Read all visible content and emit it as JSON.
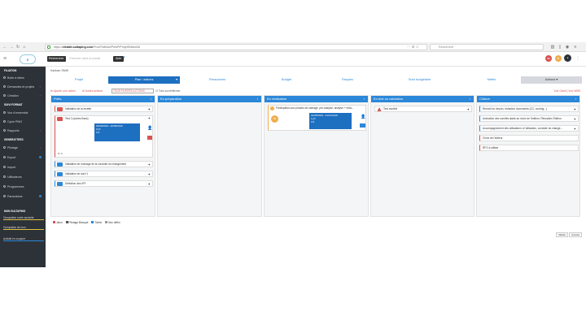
{
  "browser": {
    "url_prefix": "https://",
    "url_domain": "visiativ.sultaping.com",
    "url_path": "/ProcPortfolio/PresP/Projet/Editon0#",
    "search_placeholder": "Rechercher",
    "url_actions": "··· ⊙ ☆"
  },
  "appbar": {
    "search_button": "Rechercher",
    "search_placeholder": "Chercher dans le portail",
    "aide": "Aide",
    "badge_count": "88"
  },
  "sidebar": {
    "section1": "FILIATION",
    "items1": [
      {
        "label": "Boite à idées"
      },
      {
        "label": "Demandes et projets"
      },
      {
        "label": "Création"
      }
    ],
    "section2": "SUIVI FORMAT",
    "items2": [
      {
        "label": "Vue d'ensemble"
      },
      {
        "label": "Cycle PMO"
      },
      {
        "label": "Rapports"
      }
    ],
    "section3": "GENERATTEES",
    "items3": [
      {
        "label": "Pilotage"
      },
      {
        "label": "Export"
      },
      {
        "label": "Import"
      },
      {
        "label": "Utilisateurs"
      },
      {
        "label": "Programmes"
      },
      {
        "label": "Paramètres"
      }
    ],
    "section4": "MON SULTAPING",
    "links": [
      {
        "label": "Occupation conte auxsuite",
        "color": "#e0c040"
      },
      {
        "label": "Occupation de mon",
        "color": "#e0c040"
      },
      {
        "label": "Activité en coupure",
        "color": "#2b87d8"
      }
    ]
  },
  "breadcrumb": "Kanban SMW",
  "tabs": [
    {
      "label": "Projet"
    },
    {
      "label": "Plan / actions"
    },
    {
      "label": "Ressources"
    },
    {
      "label": "Budget"
    },
    {
      "label": "Risques"
    },
    {
      "label": "Suivi budgétaire"
    },
    {
      "label": "Météo"
    },
    {
      "label": "Actions ▾"
    }
  ],
  "toolbar": {
    "add_action": "Ajouter une action",
    "other_actions": "Autres actions",
    "filter": "TOUS FILIERES ACTIONS",
    "checkbox_label": "Tout ouvrir/fermer",
    "right_links": "Vue Gantt | Vue WBS"
  },
  "columns": [
    {
      "title": "Prêts"
    },
    {
      "title": "En préparation"
    },
    {
      "title": "En réalisation"
    },
    {
      "title": "En test ou validation"
    },
    {
      "title": "Clôturé"
    }
  ],
  "col1_cards": [
    {
      "label": "Validation de la recette"
    },
    {
      "label": "Test 2 (autres flows)"
    },
    {
      "label": "Validation de montage de la conduite du changement"
    },
    {
      "label": "Validation de suivi 1"
    },
    {
      "label": "Définition des KPI"
    }
  ],
  "col1_sub": {
    "date": "20/09/2019 - 20/09/2019",
    "line2": "0 j/h",
    "line3": "0 €",
    "counter": "0 / 1"
  },
  "col3_card": {
    "label": "Participation aux phases de cadrage, pré-analyse, analyse + réda..."
  },
  "col3_sub": {
    "date": "01/05/2019 - 31/12/2019",
    "line2": "1 j/h",
    "line3": "0 €",
    "badge": "85"
  },
  "col4_card": {
    "label": "Test modèle"
  },
  "col5_cards": [
    {
      "label": "Recueil du besoin, rédaction documents (CC, scoring...)"
    },
    {
      "label": "Animation des comités stade au choix de l'éditeur, Réception Éditeur"
    },
    {
      "label": "Accompagnement des utilisateurs à l'utilisation, conduite du change..."
    },
    {
      "label": "Choix de l'éditeur"
    },
    {
      "label": "RFO à utiliser"
    }
  ],
  "legend": [
    {
      "label": "Jalon",
      "color": "#d9534f"
    },
    {
      "label": "Pilotage Blocqué",
      "color": "#555555"
    },
    {
      "label": "Tâche",
      "color": "#2b87d8"
    },
    {
      "label": "Non défini",
      "color": "#999999"
    }
  ],
  "buttons": {
    "save": "Valider",
    "cancel": "Annuler"
  }
}
